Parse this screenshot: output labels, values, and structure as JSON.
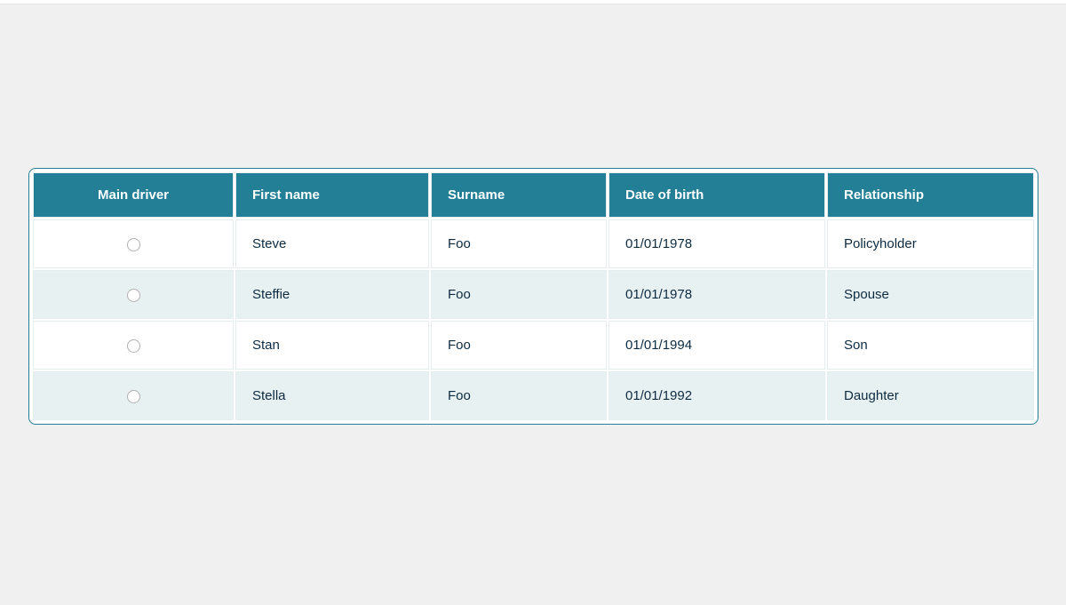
{
  "table": {
    "headers": {
      "main_driver": "Main driver",
      "first_name": "First name",
      "surname": "Surname",
      "dob": "Date of birth",
      "relationship": "Relationship"
    },
    "rows": [
      {
        "first_name": "Steve",
        "surname": "Foo",
        "dob": "01/01/1978",
        "relationship": "Policyholder"
      },
      {
        "first_name": "Steffie",
        "surname": "Foo",
        "dob": "01/01/1978",
        "relationship": "Spouse"
      },
      {
        "first_name": "Stan",
        "surname": "Foo",
        "dob": "01/01/1994",
        "relationship": "Son"
      },
      {
        "first_name": "Stella",
        "surname": "Foo",
        "dob": "01/01/1992",
        "relationship": "Daughter"
      }
    ]
  }
}
